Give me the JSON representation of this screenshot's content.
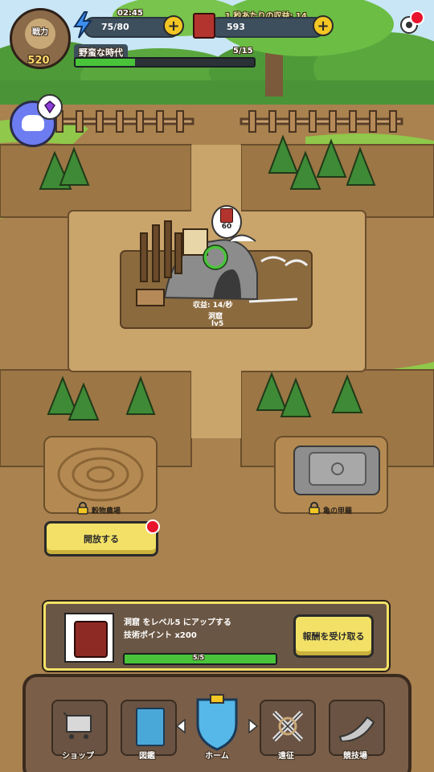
{
  "player": {
    "power_label": "戦力",
    "power_value": "520"
  },
  "header": {
    "timer": "02:45",
    "energy": "75/80",
    "income_label": "1 秒あたりの収益: 14",
    "tech_points": "593",
    "era_name": "野蛮な時代",
    "era_progress_text": "5/15",
    "era_progress_fraction": 0.333
  },
  "building": {
    "bubble_value": "60",
    "income": "収益: 14/秒",
    "name": "洞窟",
    "level": "lv5"
  },
  "locked_plots": [
    {
      "name": "穀物農場"
    },
    {
      "name": "亀の甲羅"
    }
  ],
  "unlock_button": {
    "label": "開放する"
  },
  "quest": {
    "title": "洞窟 をレベル5 にアップする",
    "reward": "技術ポイント x200",
    "progress_text": "5/5",
    "progress_fraction": 1.0,
    "claim_label": "報酬を受け取る"
  },
  "nav": {
    "shop": "ショップ",
    "collection": "図鑑",
    "home": "ホーム",
    "expedition": "遠征",
    "arena": "競技場"
  },
  "colors": {
    "dirt": "#a9824f",
    "grass": "#8fc84a",
    "accent_yellow": "#f3e167",
    "progress_green": "#49c43a",
    "notify_red": "#e8132c"
  }
}
